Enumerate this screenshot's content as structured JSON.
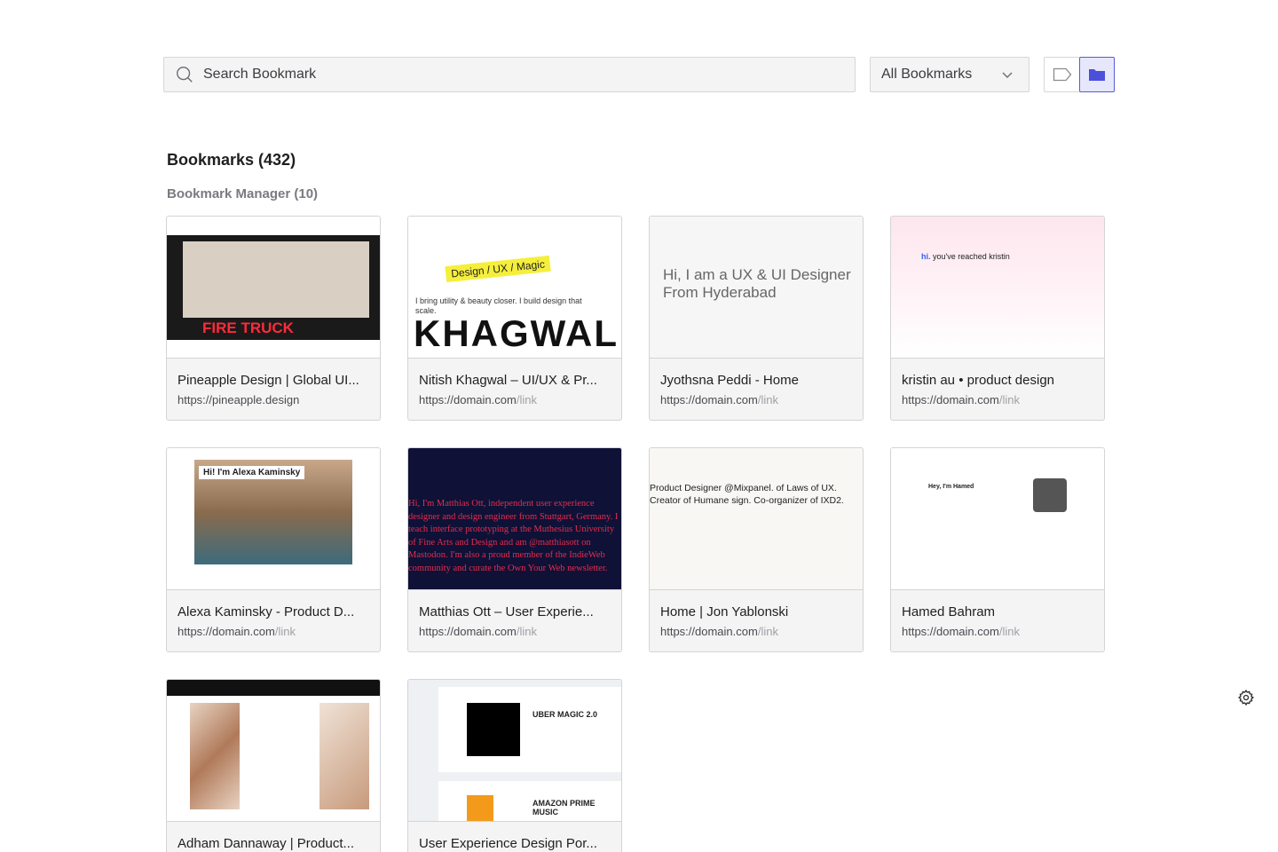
{
  "search": {
    "placeholder": "Search Bookmark",
    "value": ""
  },
  "filter": {
    "selected": "All Bookmarks"
  },
  "view_toggle": {
    "tag_view_icon": "tag-icon",
    "folder_view_icon": "folder-icon",
    "active": "folder"
  },
  "colors": {
    "accent": "#5b5bd6",
    "accent_bg": "#e6e7fb"
  },
  "page": {
    "heading": "Bookmarks (432)",
    "group_heading": "Bookmark Manager (10)"
  },
  "bookmarks": [
    {
      "title": "Pineapple Design | Global UI...",
      "url_main": "https://pineapple.design",
      "url_dim": "",
      "thumb_text": "FIRE TRUCK"
    },
    {
      "title": "Nitish Khagwal – UI/UX & Pr...",
      "url_main": "https://domain.com",
      "url_dim": "/link",
      "thumb_text": "KHAGWAL",
      "thumb_highlight": "Design / UX / Magic",
      "thumb_sub": "I bring utility & beauty closer. I build design that scale."
    },
    {
      "title": "Jyothsna Peddi - Home",
      "url_main": "https://domain.com",
      "url_dim": "/link",
      "thumb_text": "Hi, I am a UX & UI Designer From Hyderabad"
    },
    {
      "title": "kristin au • product design",
      "url_main": "https://domain.com",
      "url_dim": "/link",
      "thumb_text": "you've reached kristin",
      "thumb_em": "hi."
    },
    {
      "title": "Alexa Kaminsky - Product D...",
      "url_main": "https://domain.com",
      "url_dim": "/link",
      "thumb_text": "Hi! I'm Alexa Kaminsky"
    },
    {
      "title": "Matthias Ott – User Experie...",
      "url_main": "https://domain.com",
      "url_dim": "/link",
      "thumb_text": "Hi, I'm Matthias Ott, independent user experience designer and design engineer from Stuttgart, Germany. I teach interface prototyping at the Muthesius University of Fine Arts and Design and am @matthiasott on Mastodon. I'm also a proud member of the IndieWeb community and curate the Own Your Web newsletter."
    },
    {
      "title": "Home | Jon Yablonski",
      "url_main": "https://domain.com",
      "url_dim": "/link",
      "thumb_text": "Product Designer @Mixpanel. of Laws of UX. Creator of Humane sign. Co-organizer of IXD2."
    },
    {
      "title": "Hamed Bahram",
      "url_main": "https://domain.com",
      "url_dim": "/link",
      "thumb_text": "Hey, I'm Hamed"
    },
    {
      "title": "Adham Dannaway | Product...",
      "url_main": "",
      "url_dim": ""
    },
    {
      "title": "User Experience Design Por...",
      "url_main": "",
      "url_dim": "",
      "thumb_text": "UBER MAGIC 2.0",
      "thumb_text2": "AMAZON PRIME MUSIC"
    }
  ],
  "settings_icon": "gear-icon"
}
